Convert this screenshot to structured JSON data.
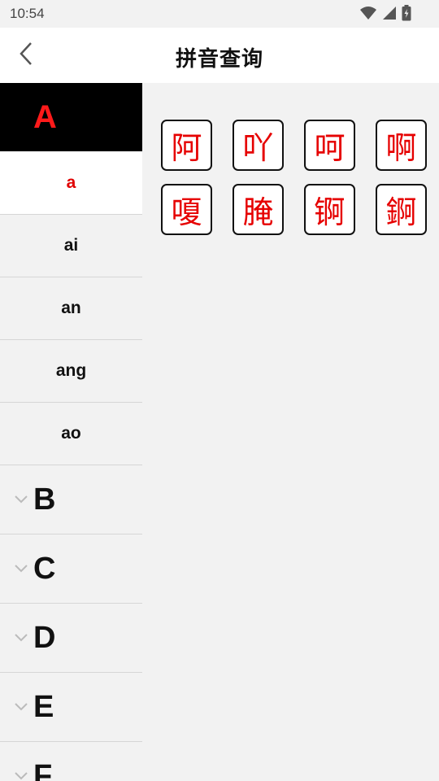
{
  "status_bar": {
    "time": "10:54",
    "icons": [
      "wifi-icon",
      "signal-icon",
      "battery-icon"
    ]
  },
  "app_bar": {
    "title": "拼音查询",
    "back_icon": "chevron-left-icon"
  },
  "sidebar": {
    "active_group": "A",
    "syllables": [
      {
        "label": "a",
        "selected": true
      },
      {
        "label": "ai",
        "selected": false
      },
      {
        "label": "an",
        "selected": false
      },
      {
        "label": "ang",
        "selected": false
      },
      {
        "label": "ao",
        "selected": false
      }
    ],
    "groups": [
      "B",
      "C",
      "D",
      "E",
      "F"
    ]
  },
  "characters": [
    "阿",
    "吖",
    "呵",
    "啊",
    "嗄",
    "腌",
    "锕",
    "錒"
  ],
  "colors": {
    "accent": "#e00000",
    "active_header_bg": "#000000",
    "bg": "#f2f2f2"
  }
}
